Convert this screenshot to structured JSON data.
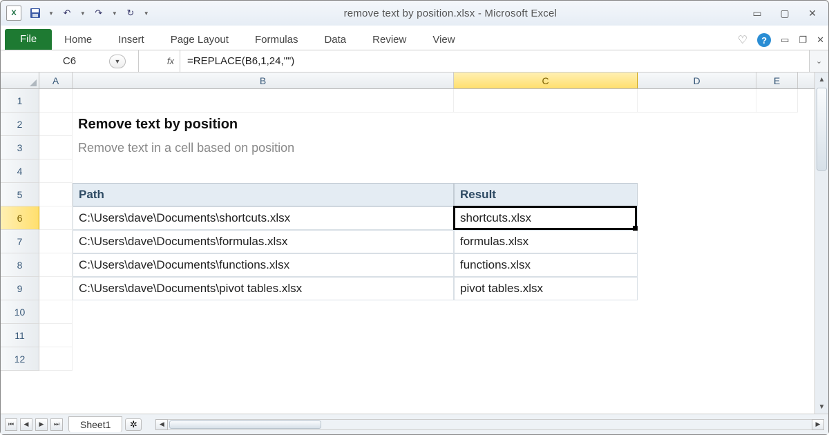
{
  "window": {
    "title": "remove text by position.xlsx  -  Microsoft Excel",
    "excel_icon_label": "X"
  },
  "ribbon": {
    "file": "File",
    "tabs": [
      "Home",
      "Insert",
      "Page Layout",
      "Formulas",
      "Data",
      "Review",
      "View"
    ]
  },
  "formula_bar": {
    "name_box": "C6",
    "fx_label": "fx",
    "formula": "=REPLACE(B6,1,24,\"\")"
  },
  "columns": [
    "A",
    "B",
    "C",
    "D",
    "E"
  ],
  "row_numbers": [
    "1",
    "2",
    "3",
    "4",
    "5",
    "6",
    "7",
    "8",
    "9",
    "10",
    "11",
    "12"
  ],
  "content": {
    "title": "Remove text by position",
    "subtitle": "Remove text in a cell based on position",
    "headers": {
      "path": "Path",
      "result": "Result"
    },
    "rows": [
      {
        "path": "C:\\Users\\dave\\Documents\\shortcuts.xlsx",
        "result": "shortcuts.xlsx"
      },
      {
        "path": "C:\\Users\\dave\\Documents\\formulas.xlsx",
        "result": "formulas.xlsx"
      },
      {
        "path": "C:\\Users\\dave\\Documents\\functions.xlsx",
        "result": "functions.xlsx"
      },
      {
        "path": "C:\\Users\\dave\\Documents\\pivot tables.xlsx",
        "result": "pivot tables.xlsx"
      }
    ]
  },
  "sheets": {
    "active": "Sheet1"
  },
  "active_cell": "C6"
}
